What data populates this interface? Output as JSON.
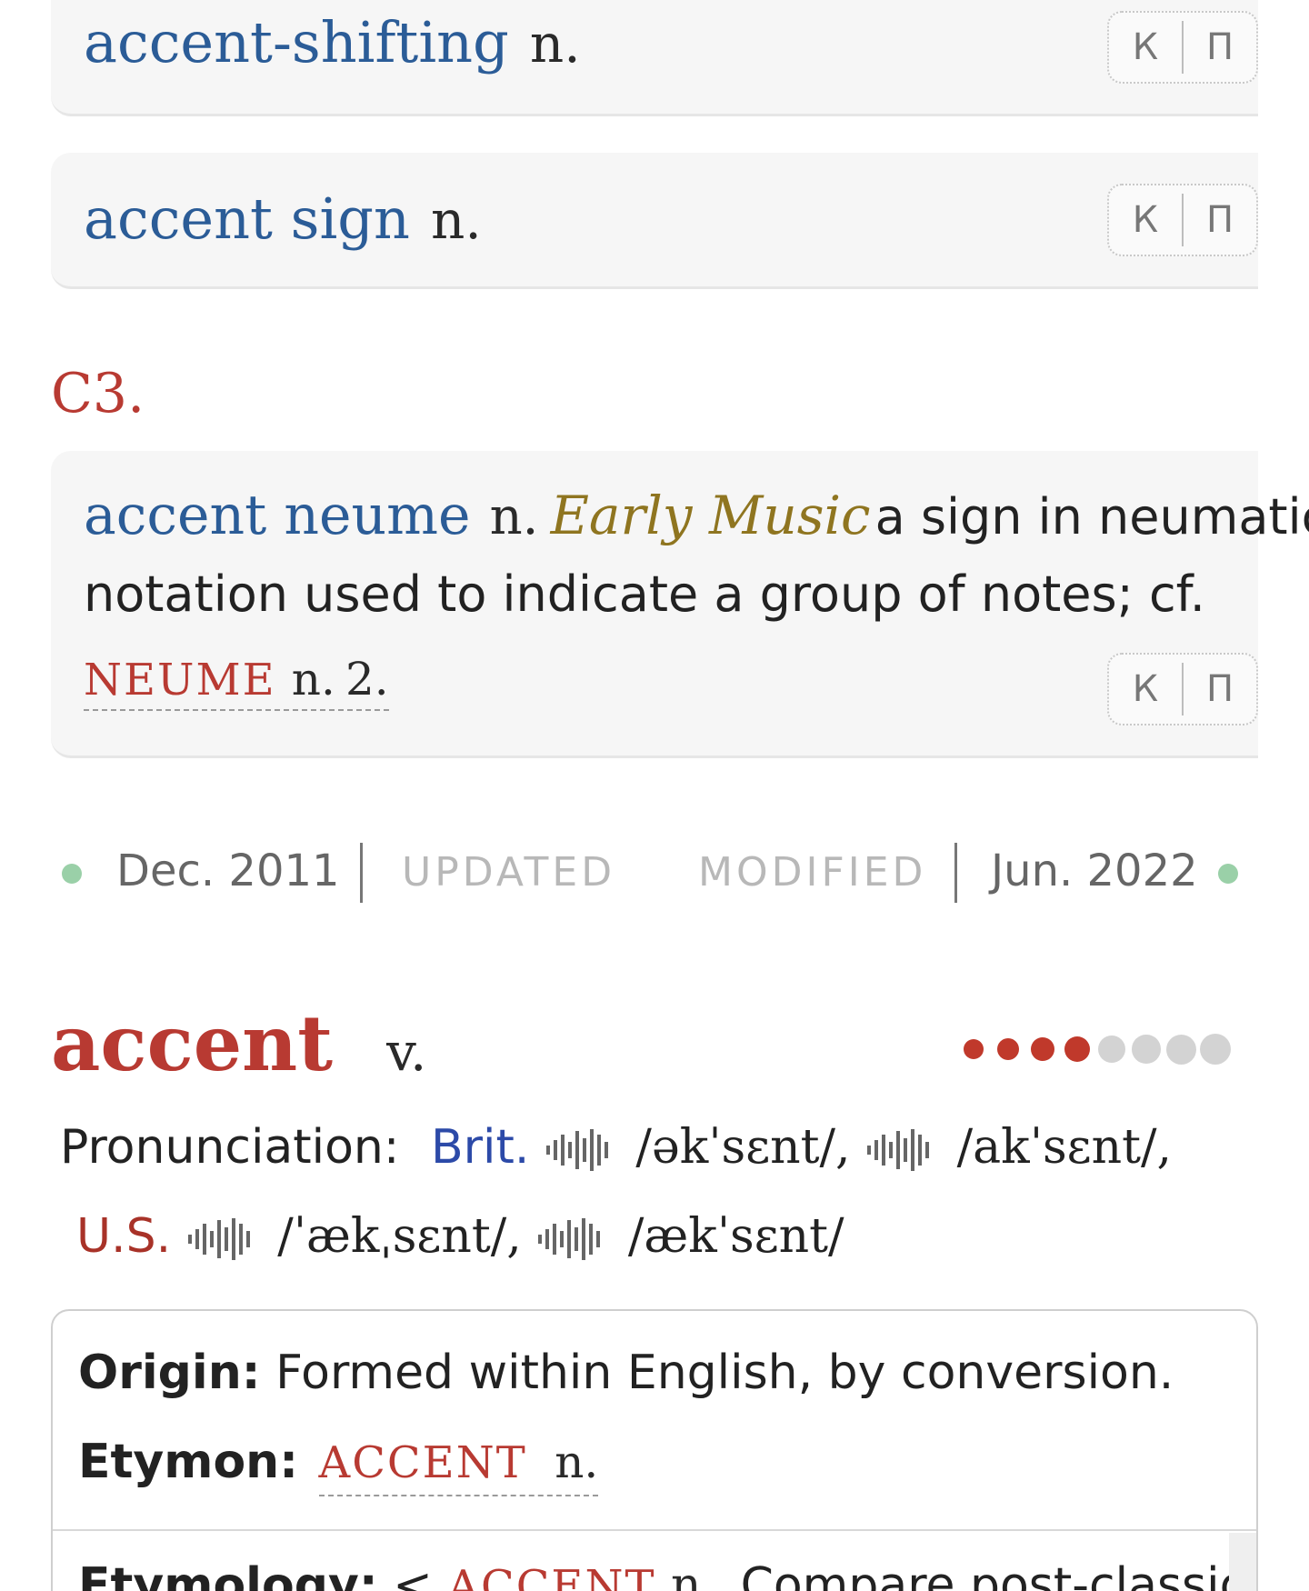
{
  "entries": [
    {
      "lemma": "accent-shifting",
      "pos": "n."
    },
    {
      "lemma": "accent sign",
      "pos": "n."
    },
    {
      "lemma": "accent neume",
      "pos": "n.",
      "subject": "Early Music",
      "definition_line1": "a sign in neumatic",
      "definition_line2": "notation used to indicate a group of notes; cf.",
      "xref_word": "NEUME",
      "xref_pos": "n.",
      "xref_sense": "2."
    }
  ],
  "kp_buttons": {
    "k": "К",
    "p": "П"
  },
  "section_label": "C3.",
  "dates": {
    "first": "Dec. 2011",
    "updated_label": "UPDATED",
    "modified_label": "MODIFIED",
    "second": "Jun. 2022"
  },
  "headword": {
    "word": "accent",
    "pos": "v.",
    "frequency_filled": 4,
    "frequency_total": 8,
    "colors": {
      "headword": "#b83a32",
      "freq_on": "#c0392b",
      "freq_off": "#d3d3d3"
    }
  },
  "pronunciation": {
    "label": "Pronunciation:",
    "brit_label": "Brit.",
    "brit_1": "/əkˈsɛnt/,",
    "brit_2": "/akˈsɛnt/,",
    "us_label": "U.S.",
    "us_1": "/ˈækˌsɛnt/,",
    "us_2": "/ækˈsɛnt/"
  },
  "origin": {
    "origin_label": "Origin:",
    "origin_text": "Formed within English, by conversion.",
    "etymon_label": "Etymon:",
    "etymon_word": "ACCENT",
    "etymon_pos": "n."
  },
  "etymology": {
    "label": "Etymology:",
    "lt": "<",
    "word": "ACCENT",
    "pos": "n.",
    "text": "Compare post-classical"
  }
}
